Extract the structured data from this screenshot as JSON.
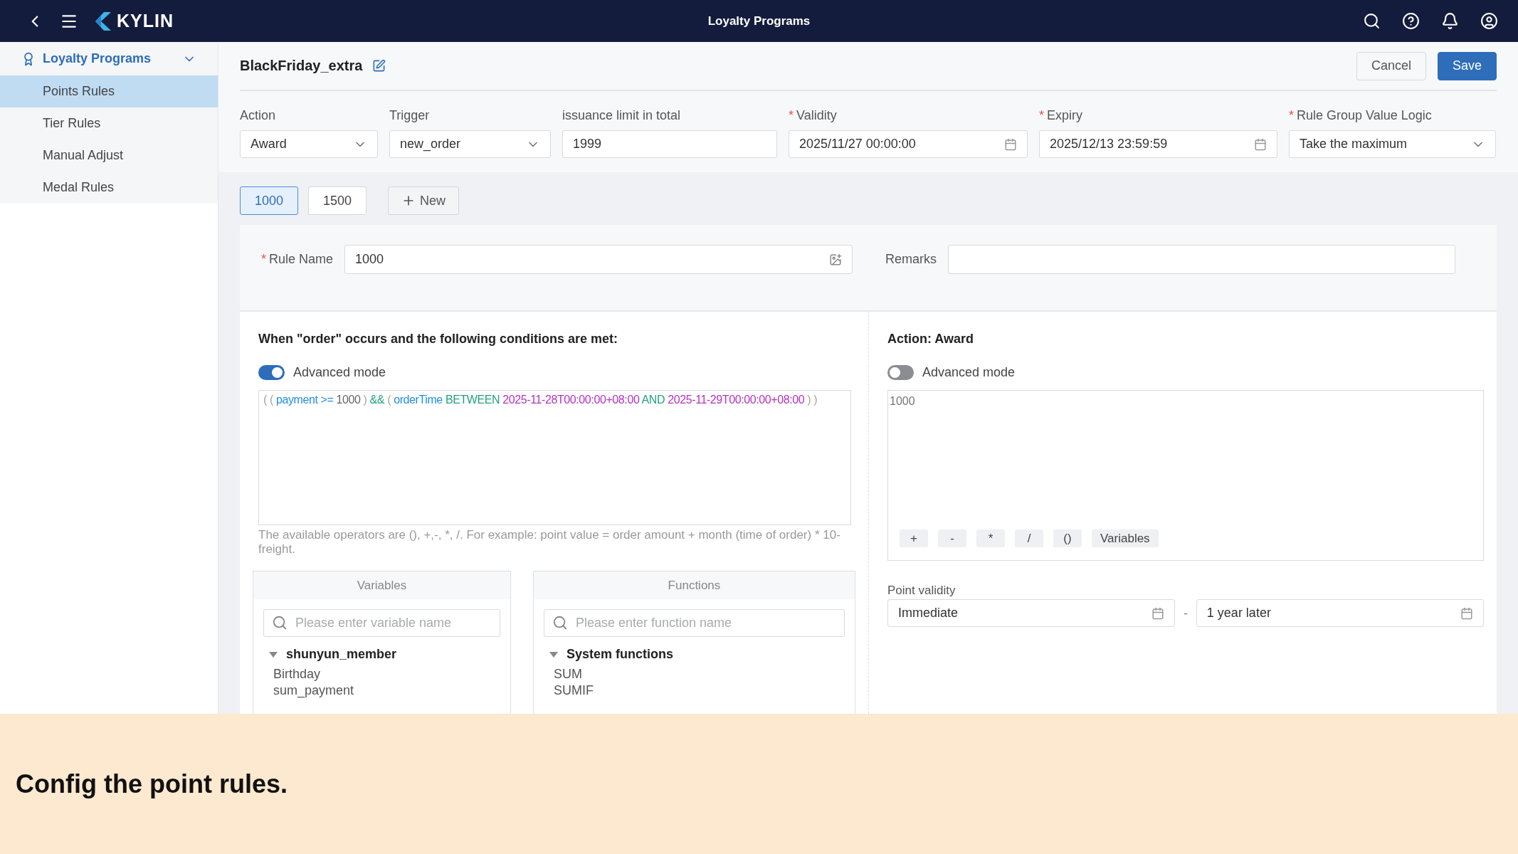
{
  "topbar": {
    "brand": "KYLIN",
    "title": "Loyalty Programs"
  },
  "sidebar": {
    "group": {
      "label": "Loyalty Programs",
      "expanded": true
    },
    "items": [
      {
        "label": "Points Rules",
        "selected": true
      },
      {
        "label": "Tier Rules",
        "selected": false
      },
      {
        "label": "Manual Adjust",
        "selected": false
      },
      {
        "label": "Medal Rules",
        "selected": false
      }
    ]
  },
  "header": {
    "title": "BlackFriday_extra",
    "buttons": [
      {
        "label": "Cancel",
        "kind": "secondary"
      },
      {
        "label": "Save",
        "kind": "primary"
      }
    ]
  },
  "fields": [
    {
      "label": "Action",
      "required": false,
      "kind": "select",
      "value": "Award"
    },
    {
      "label": "Trigger",
      "required": false,
      "kind": "select",
      "value": "new_order"
    },
    {
      "label": "issuance limit in total",
      "required": false,
      "kind": "text",
      "value": "1999"
    },
    {
      "label": "Validity",
      "required": true,
      "kind": "date",
      "value": "2025/11/27 00:00:00"
    },
    {
      "label": "Expiry",
      "required": true,
      "kind": "date",
      "value": "2025/12/13 23:59:59"
    },
    {
      "label": "Rule Group Value Logic",
      "required": true,
      "kind": "select",
      "value": "Take the maximum"
    }
  ],
  "rule_tabs": [
    {
      "label": "1000",
      "selected": true
    },
    {
      "label": "1500",
      "selected": false
    }
  ],
  "new_button": "New",
  "rule_name": {
    "label": "Rule Name",
    "required": true,
    "value": "1000"
  },
  "remarks": {
    "label": "Remarks"
  },
  "condition": {
    "title": "When \"order\" occurs and the following conditions are met:",
    "advanced_mode": {
      "label": "Advanced mode",
      "on": true
    },
    "code": [
      {
        "text": "(",
        "kind": "paren"
      },
      {
        "text": "(",
        "kind": "paren"
      },
      {
        "text": "payment",
        "kind": "variable"
      },
      {
        "text": ">=",
        "kind": "operator"
      },
      {
        "text": "1000",
        "kind": "number"
      },
      {
        "text": ")",
        "kind": "paren"
      },
      {
        "text": "&&",
        "kind": "keyword"
      },
      {
        "text": "(",
        "kind": "paren"
      },
      {
        "text": "orderTime",
        "kind": "variable"
      },
      {
        "text": "BETWEEN",
        "kind": "keyword"
      },
      {
        "text": "2025-11-28T00:00:00+08:00",
        "kind": "value"
      },
      {
        "text": "AND",
        "kind": "keyword"
      },
      {
        "text": "2025-11-29T00:00:00+08:00",
        "kind": "value"
      },
      {
        "text": ")",
        "kind": "paren"
      },
      {
        "text": ")",
        "kind": "paren"
      }
    ],
    "hint": "The available operators are (), +,-, *, /. For example: point value = order amount + month (time of order) * 10-freight.",
    "variables": {
      "title": "Variables",
      "placeholder": "Please enter variable name",
      "group": {
        "label": "shunyun_member",
        "expanded": true,
        "items": [
          "Birthday",
          "sum_payment"
        ]
      }
    },
    "functions": {
      "title": "Functions",
      "placeholder": "Please enter function name",
      "group": {
        "label": "System functions",
        "expanded": true,
        "items": [
          "SUM",
          "SUMIF"
        ]
      }
    }
  },
  "action": {
    "title": "Action: Award",
    "advanced_mode": {
      "label": "Advanced mode",
      "on": false
    },
    "value": "1000",
    "operators": [
      "+",
      "-",
      "*",
      "/",
      "()",
      "Variables"
    ],
    "point_validity": {
      "label": "Point validity",
      "from": "Immediate",
      "separator": "-",
      "to": "1 year later"
    }
  },
  "caption": "Config the point rules."
}
